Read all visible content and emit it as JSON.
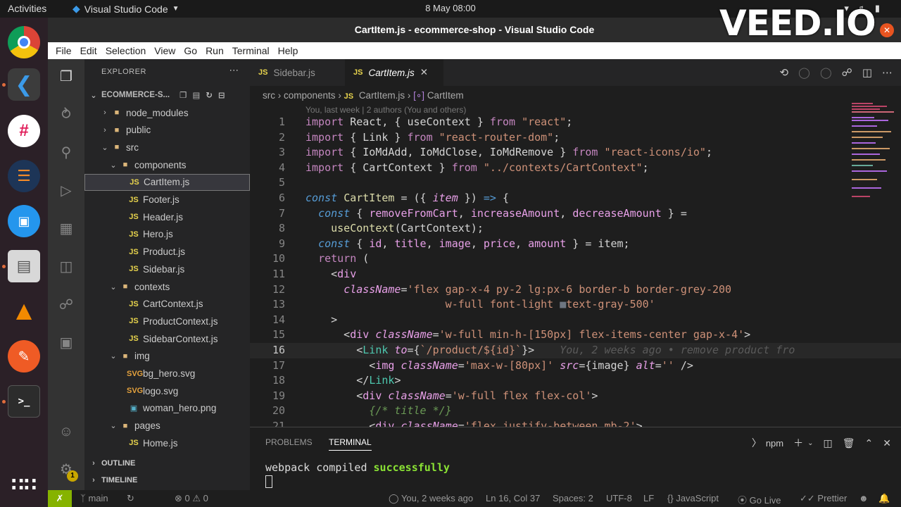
{
  "topbar": {
    "activities": "Activities",
    "app_name": "Visual Studio Code",
    "clock": "8 May  08:00"
  },
  "watermark": "VEED.IO",
  "window": {
    "title": "CartItem.js - ecommerce-shop - Visual Studio Code"
  },
  "menu": [
    "File",
    "Edit",
    "Selection",
    "View",
    "Go",
    "Run",
    "Terminal",
    "Help"
  ],
  "explorer": {
    "header": "EXPLORER",
    "project": "ECOMMERCE-S...",
    "items": [
      {
        "label": "node_modules",
        "type": "folder",
        "depth": 1,
        "open": false
      },
      {
        "label": "public",
        "type": "folder",
        "depth": 1,
        "open": false
      },
      {
        "label": "src",
        "type": "folder",
        "depth": 1,
        "open": true
      },
      {
        "label": "components",
        "type": "folder",
        "depth": 2,
        "open": true
      },
      {
        "label": "CartItem.js",
        "type": "js",
        "depth": 3,
        "selected": true
      },
      {
        "label": "Footer.js",
        "type": "js",
        "depth": 3
      },
      {
        "label": "Header.js",
        "type": "js",
        "depth": 3
      },
      {
        "label": "Hero.js",
        "type": "js",
        "depth": 3
      },
      {
        "label": "Product.js",
        "type": "js",
        "depth": 3
      },
      {
        "label": "Sidebar.js",
        "type": "js",
        "depth": 3
      },
      {
        "label": "contexts",
        "type": "folder",
        "depth": 2,
        "open": true
      },
      {
        "label": "CartContext.js",
        "type": "js",
        "depth": 3
      },
      {
        "label": "ProductContext.js",
        "type": "js",
        "depth": 3
      },
      {
        "label": "SidebarContext.js",
        "type": "js",
        "depth": 3
      },
      {
        "label": "img",
        "type": "folder",
        "depth": 2,
        "open": true
      },
      {
        "label": "bg_hero.svg",
        "type": "svg",
        "depth": 3
      },
      {
        "label": "logo.svg",
        "type": "svg",
        "depth": 3
      },
      {
        "label": "woman_hero.png",
        "type": "png",
        "depth": 3
      },
      {
        "label": "pages",
        "type": "folder",
        "depth": 2,
        "open": true
      },
      {
        "label": "Home.js",
        "type": "js",
        "depth": 3
      }
    ],
    "outline": "OUTLINE",
    "timeline": "TIMELINE"
  },
  "tabs": [
    {
      "label": "Sidebar.js",
      "active": false
    },
    {
      "label": "CartItem.js",
      "active": true
    }
  ],
  "tab_js_label": "JS",
  "breadcrumb": [
    "src",
    "components",
    "CartItem.js",
    "CartItem"
  ],
  "blame_header": "You, last week | 2 authors (You and others)",
  "code_lines": [
    {
      "n": "1",
      "html": "<span style='color:#c586c0'>import</span> React, { useContext } <span style='color:#c586c0'>from</span> <span style='color:#ce9178'>\"react\"</span>;"
    },
    {
      "n": "2",
      "html": "<span style='color:#c586c0'>import</span> { Link } <span style='color:#c586c0'>from</span> <span style='color:#ce9178'>\"react-router-dom\"</span>;"
    },
    {
      "n": "3",
      "html": "<span style='color:#c586c0'>import</span> { IoMdAdd, IoMdClose, IoMdRemove } <span style='color:#c586c0'>from</span> <span style='color:#ce9178'>\"react-icons/io\"</span>;"
    },
    {
      "n": "4",
      "html": "<span style='color:#c586c0'>import</span> { CartContext } <span style='color:#c586c0'>from</span> <span style='color:#ce9178'>\"../contexts/CartContext\"</span>;"
    },
    {
      "n": "5",
      "html": ""
    },
    {
      "n": "6",
      "html": "<span style='color:#569cd6;font-style:italic'>const</span> <span style='color:#dcdcaa'>CartItem</span> = ({ <span style='color:#e8a0e8;font-style:italic'>item</span> }) <span style='color:#569cd6'>=&gt;</span> {"
    },
    {
      "n": "7",
      "html": "  <span style='color:#569cd6;font-style:italic'>const</span> { <span style='color:#e8a0e8'>removeFromCart</span>, <span style='color:#e8a0e8'>increaseAmount</span>, <span style='color:#e8a0e8'>decreaseAmount</span> } ="
    },
    {
      "n": "8",
      "html": "    <span style='color:#dcdcaa'>useContext</span>(CartContext);"
    },
    {
      "n": "9",
      "html": "  <span style='color:#569cd6;font-style:italic'>const</span> { <span style='color:#e8a0e8'>id</span>, <span style='color:#e8a0e8'>title</span>, <span style='color:#e8a0e8'>image</span>, <span style='color:#e8a0e8'>price</span>, <span style='color:#e8a0e8'>amount</span> } = item;"
    },
    {
      "n": "10",
      "html": "  <span style='color:#c586c0'>return</span> ("
    },
    {
      "n": "11",
      "html": "    &lt;<span style='color:#e8a0e8'>div</span>"
    },
    {
      "n": "12",
      "html": "      <span style='color:#e8a0e8;font-style:italic'>className</span>=<span style='color:#ce9178'>'flex gap-x-4 py-2 lg:px-6 border-b border-grey-200</span>"
    },
    {
      "n": "13",
      "html": "<span style='color:#ce9178'>                      w-full font-light </span><span style='color:#6e7681'>&#9632;</span><span style='color:#ce9178'>text-gray-500'</span>"
    },
    {
      "n": "14",
      "html": "    &gt;"
    },
    {
      "n": "15",
      "html": "      &lt;<span style='color:#e8a0e8'>div</span> <span style='color:#e8a0e8;font-style:italic'>className</span>=<span style='color:#ce9178'>'w-full min-h-[150px] flex-items-center gap-x-4'</span>&gt;"
    },
    {
      "n": "16",
      "html": "        &lt;<span style='color:#4ec9b0'>Link</span> <span style='color:#e8a0e8;font-style:italic'>to</span>={<span style='color:#ce9178'>`/product/${id}`</span>}&gt;    <span style='color:#5a5a5a;font-style:italic'>You, 2 weeks ago • remove product fro</span>"
    },
    {
      "n": "17",
      "html": "          &lt;<span style='color:#e8a0e8'>img</span> <span style='color:#e8a0e8;font-style:italic'>className</span>=<span style='color:#ce9178'>'max-w-[80px]'</span> <span style='color:#e8a0e8;font-style:italic'>src</span>={image} <span style='color:#e8a0e8;font-style:italic'>alt</span>=<span style='color:#ce9178'>''</span> /&gt;"
    },
    {
      "n": "18",
      "html": "        &lt;/<span style='color:#4ec9b0'>Link</span>&gt;"
    },
    {
      "n": "19",
      "html": "        &lt;<span style='color:#e8a0e8'>div</span> <span style='color:#e8a0e8;font-style:italic'>className</span>=<span style='color:#ce9178'>'w-full flex flex-col'</span>&gt;"
    },
    {
      "n": "20",
      "html": "          <span style='color:#6a9955;font-style:italic'>{/* title */}</span>"
    },
    {
      "n": "21",
      "html": "          &lt;<span style='color:#e8a0e8'>div</span> <span style='color:#e8a0e8;font-style:italic'>className</span>=<span style='color:#ce9178'>'flex justify-between mb-2'</span>&gt;"
    }
  ],
  "current_line": "16",
  "panel": {
    "tabs": [
      "PROBLEMS",
      "TERMINAL"
    ],
    "active_tab": "TERMINAL",
    "terminal_name": "npm",
    "output_prefix": "webpack compiled ",
    "output_status": "successfully"
  },
  "statusbar": {
    "branch": "main",
    "problems": "0",
    "warnings": "0",
    "blame": "You, 2 weeks ago",
    "position": "Ln 16, Col 37",
    "spaces": "Spaces: 2",
    "encoding": "UTF-8",
    "eol": "LF",
    "language": "JavaScript",
    "golive": "Go Live",
    "prettier": "Prettier"
  },
  "settings_badge": "1",
  "colors": {
    "remote": "#86b300",
    "accent_tab": "#e8d44d",
    "success": "#8ae234"
  }
}
